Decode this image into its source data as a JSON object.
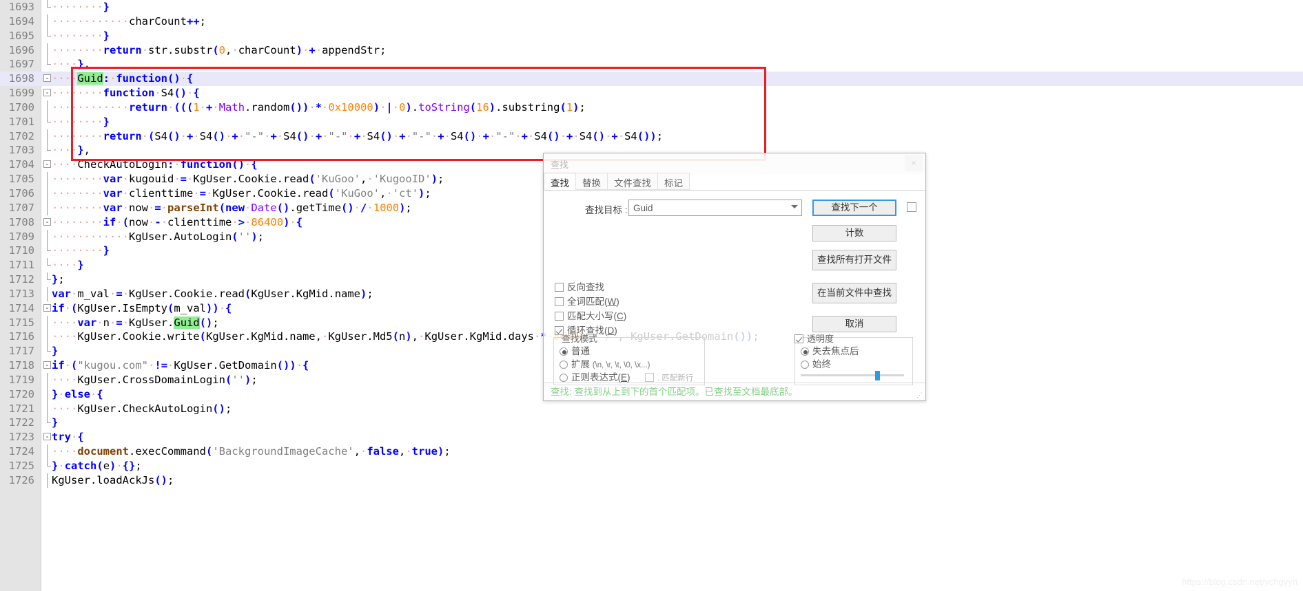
{
  "editor": {
    "first_line": 1693,
    "current_line": 1698,
    "highlight_term": "Guid",
    "lines": [
      {
        "n": 1693,
        "fold": "end",
        "html": "<span class=\"ws\">&middot;&middot;&middot;&middot;&middot;&middot;&middot;&middot;</span><span class=\"op\">}</span>"
      },
      {
        "n": 1694,
        "fold": "",
        "html": "<span class=\"ws\">&middot;&middot;&middot;&middot;&middot;&middot;&middot;&middot;&middot;&middot;&middot;&middot;</span>charCount<span class=\"op\">++</span>;"
      },
      {
        "n": 1695,
        "fold": "end",
        "html": "<span class=\"ws\">&middot;&middot;&middot;&middot;&middot;&middot;&middot;&middot;</span><span class=\"op\">}</span>"
      },
      {
        "n": 1696,
        "fold": "",
        "html": "<span class=\"ws\">&middot;&middot;&middot;&middot;&middot;&middot;&middot;&middot;</span><span class=\"kw\">return</span><span class=\"ws\">&middot;</span>str.substr<span class=\"op\">(</span><span class=\"num\">0</span>,<span class=\"ws\">&middot;</span>charCount<span class=\"op\">)</span><span class=\"ws\">&middot;</span><span class=\"op\">+</span><span class=\"ws\">&middot;</span>appendStr;"
      },
      {
        "n": 1697,
        "fold": "end",
        "html": "<span class=\"ws\">&middot;&middot;&middot;&middot;</span><span class=\"op\">}</span>,"
      },
      {
        "n": 1698,
        "fold": "box",
        "html": "<span class=\"ws\">&middot;&middot;&middot;&middot;</span><span class=\"hl\">Guid</span><span class=\"op\">:</span><span class=\"ws\">&middot;</span><span class=\"kw\">function</span><span class=\"op\">()</span><span class=\"ws\">&middot;</span><span class=\"op\">{</span>"
      },
      {
        "n": 1699,
        "fold": "box",
        "html": "<span class=\"ws\">&middot;&middot;&middot;&middot;&middot;&middot;&middot;&middot;</span><span class=\"kw\">function</span><span class=\"ws\">&middot;</span>S4<span class=\"op\">()</span><span class=\"ws\">&middot;</span><span class=\"op\">{</span>"
      },
      {
        "n": 1700,
        "fold": "",
        "html": "<span class=\"ws\">&middot;&middot;&middot;&middot;&middot;&middot;&middot;&middot;&middot;&middot;&middot;&middot;</span><span class=\"kw\">return</span><span class=\"ws\">&middot;</span><span class=\"op\">(((</span><span class=\"num\">1</span><span class=\"ws\">&middot;</span><span class=\"op\">+</span><span class=\"ws\">&middot;</span><span class=\"fn\">Math</span>.random<span class=\"op\">())</span><span class=\"ws\">&middot;</span><span class=\"op\">*</span><span class=\"ws\">&middot;</span><span class=\"num\">0x10000</span><span class=\"op\">)</span><span class=\"ws\">&middot;</span><span class=\"op\">|</span><span class=\"ws\">&middot;</span><span class=\"num\">0</span><span class=\"op\">)</span>.<span class=\"fn\">toString</span><span class=\"op\">(</span><span class=\"num\">16</span><span class=\"op\">)</span>.substring<span class=\"op\">(</span><span class=\"num\">1</span><span class=\"op\">)</span>;"
      },
      {
        "n": 1701,
        "fold": "end",
        "html": "<span class=\"ws\">&middot;&middot;&middot;&middot;&middot;&middot;&middot;&middot;</span><span class=\"op\">}</span>"
      },
      {
        "n": 1702,
        "fold": "",
        "html": "<span class=\"ws\">&middot;&middot;&middot;&middot;&middot;&middot;&middot;&middot;</span><span class=\"kw\">return</span><span class=\"ws\">&middot;</span><span class=\"op\">(</span>S4<span class=\"op\">()</span><span class=\"ws\">&middot;</span><span class=\"op\">+</span><span class=\"ws\">&middot;</span>S4<span class=\"op\">()</span><span class=\"ws\">&middot;</span><span class=\"op\">+</span><span class=\"ws\">&middot;</span><span class=\"str\">\"-\"</span><span class=\"ws\">&middot;</span><span class=\"op\">+</span><span class=\"ws\">&middot;</span>S4<span class=\"op\">()</span><span class=\"ws\">&middot;</span><span class=\"op\">+</span><span class=\"ws\">&middot;</span><span class=\"str\">\"-\"</span><span class=\"ws\">&middot;</span><span class=\"op\">+</span><span class=\"ws\">&middot;</span>S4<span class=\"op\">()</span><span class=\"ws\">&middot;</span><span class=\"op\">+</span><span class=\"ws\">&middot;</span><span class=\"str\">\"-\"</span><span class=\"ws\">&middot;</span><span class=\"op\">+</span><span class=\"ws\">&middot;</span>S4<span class=\"op\">()</span><span class=\"ws\">&middot;</span><span class=\"op\">+</span><span class=\"ws\">&middot;</span><span class=\"str\">\"-\"</span><span class=\"ws\">&middot;</span><span class=\"op\">+</span><span class=\"ws\">&middot;</span>S4<span class=\"op\">()</span><span class=\"ws\">&middot;</span><span class=\"op\">+</span><span class=\"ws\">&middot;</span>S4<span class=\"op\">()</span><span class=\"ws\">&middot;</span><span class=\"op\">+</span><span class=\"ws\">&middot;</span>S4<span class=\"op\">())</span>;"
      },
      {
        "n": 1703,
        "fold": "end",
        "html": "<span class=\"ws\">&middot;&middot;&middot;&middot;</span><span class=\"op\">}</span>,"
      },
      {
        "n": 1704,
        "fold": "box",
        "html": "<span class=\"ws\">&middot;&middot;&middot;&middot;</span>CheckAutoLogin<span class=\"op\">:</span><span class=\"ws\">&middot;</span><span class=\"kw\">function</span><span class=\"op\">()</span><span class=\"ws\">&middot;</span><span class=\"op\">{</span>"
      },
      {
        "n": 1705,
        "fold": "",
        "html": "<span class=\"ws\">&middot;&middot;&middot;&middot;&middot;&middot;&middot;&middot;</span><span class=\"kw\">var</span><span class=\"ws\">&middot;</span>kugouid<span class=\"ws\">&middot;</span><span class=\"op\">=</span><span class=\"ws\">&middot;</span>KgUser.Cookie.read<span class=\"op\">(</span><span class=\"str\">'KuGoo'</span>,<span class=\"ws\">&middot;</span><span class=\"str\">'KugooID'</span><span class=\"op\">)</span>;"
      },
      {
        "n": 1706,
        "fold": "",
        "html": "<span class=\"ws\">&middot;&middot;&middot;&middot;&middot;&middot;&middot;&middot;</span><span class=\"kw\">var</span><span class=\"ws\">&middot;</span>clienttime<span class=\"ws\">&middot;</span><span class=\"op\">=</span><span class=\"ws\">&middot;</span>KgUser.Cookie.read<span class=\"op\">(</span><span class=\"str\">'KuGoo'</span>,<span class=\"ws\">&middot;</span><span class=\"str\">'ct'</span><span class=\"op\">)</span>;"
      },
      {
        "n": 1707,
        "fold": "",
        "html": "<span class=\"ws\">&middot;&middot;&middot;&middot;&middot;&middot;&middot;&middot;</span><span class=\"kw\">var</span><span class=\"ws\">&middot;</span>now<span class=\"ws\">&middot;</span><span class=\"op\">=</span><span class=\"ws\">&middot;</span><span class=\"dark\">parseInt</span><span class=\"op\">(</span><span class=\"kw\">new</span><span class=\"ws\">&middot;</span><span class=\"fn\">Date</span><span class=\"op\">()</span>.getTime<span class=\"op\">()</span><span class=\"ws\">&middot;</span><span class=\"op\">/</span><span class=\"ws\">&middot;</span><span class=\"num\">1000</span><span class=\"op\">)</span>;"
      },
      {
        "n": 1708,
        "fold": "box",
        "html": "<span class=\"ws\">&middot;&middot;&middot;&middot;&middot;&middot;&middot;&middot;</span><span class=\"kw\">if</span><span class=\"ws\">&middot;</span><span class=\"op\">(</span>now<span class=\"ws\">&middot;</span><span class=\"op\">-</span><span class=\"ws\">&middot;</span>clienttime<span class=\"ws\">&middot;</span><span class=\"op\">&gt;</span><span class=\"ws\">&middot;</span><span class=\"num\">86400</span><span class=\"op\">)</span><span class=\"ws\">&middot;</span><span class=\"op\">{</span>"
      },
      {
        "n": 1709,
        "fold": "",
        "html": "<span class=\"ws\">&middot;&middot;&middot;&middot;&middot;&middot;&middot;&middot;&middot;&middot;&middot;&middot;</span>KgUser.AutoLogin<span class=\"op\">(</span><span class=\"str\">''</span><span class=\"op\">)</span>;"
      },
      {
        "n": 1710,
        "fold": "end",
        "html": "<span class=\"ws\">&middot;&middot;&middot;&middot;&middot;&middot;&middot;&middot;</span><span class=\"op\">}</span>"
      },
      {
        "n": 1711,
        "fold": "end",
        "html": "<span class=\"ws\">&middot;&middot;&middot;&middot;</span><span class=\"op\">}</span>"
      },
      {
        "n": 1712,
        "fold": "end",
        "html": "<span class=\"op\">}</span>;"
      },
      {
        "n": 1713,
        "fold": "",
        "html": "<span class=\"kw\">var</span><span class=\"ws\">&middot;</span>m_val<span class=\"ws\">&middot;</span><span class=\"op\">=</span><span class=\"ws\">&middot;</span>KgUser.Cookie.read<span class=\"op\">(</span>KgUser.KgMid.name<span class=\"op\">)</span>;"
      },
      {
        "n": 1714,
        "fold": "box",
        "html": "<span class=\"kw\">if</span><span class=\"ws\">&middot;</span><span class=\"op\">(</span>KgUser.IsEmpty<span class=\"op\">(</span>m_val<span class=\"op\">))</span><span class=\"ws\">&middot;</span><span class=\"op\">{</span>"
      },
      {
        "n": 1715,
        "fold": "",
        "html": "<span class=\"ws\">&middot;&middot;&middot;&middot;</span><span class=\"kw\">var</span><span class=\"ws\">&middot;</span>n<span class=\"ws\">&middot;</span><span class=\"op\">=</span><span class=\"ws\">&middot;</span>KgUser.<span class=\"hl\">Guid</span><span class=\"op\">()</span>;"
      },
      {
        "n": 1716,
        "fold": "",
        "html": "<span class=\"ws\">&middot;&middot;&middot;&middot;</span>KgUser.Cookie.write<span class=\"op\">(</span>KgUser.KgMid.name,<span class=\"ws\">&middot;</span>KgUser.Md5<span class=\"op\">(</span>n<span class=\"op\">)</span>,<span class=\"ws\">&middot;</span>KgUser.KgMid.days<span class=\"ws\">&middot;</span><span class=\"op\">*</span><span class=\"ws\">&middot;</span><span class=\"num\">86400</span>,<span class=\"ws\">&middot;</span><span class=\"str\">\"/\"</span>,<span class=\"ws\">&middot;</span>KgUser.GetDomain<span class=\"op\">())</span>;"
      },
      {
        "n": 1717,
        "fold": "end",
        "html": "<span class=\"op\">}</span>"
      },
      {
        "n": 1718,
        "fold": "box",
        "html": "<span class=\"kw\">if</span><span class=\"ws\">&middot;</span><span class=\"op\">(</span><span class=\"str\">\"kugou.com\"</span><span class=\"ws\">&middot;</span><span class=\"op\">!=</span><span class=\"ws\">&middot;</span>KgUser.GetDomain<span class=\"op\">())</span><span class=\"ws\">&middot;</span><span class=\"op\">{</span>"
      },
      {
        "n": 1719,
        "fold": "",
        "html": "<span class=\"ws\">&middot;&middot;&middot;&middot;</span>KgUser.CrossDomainLogin<span class=\"op\">(</span><span class=\"str\">''</span><span class=\"op\">)</span>;"
      },
      {
        "n": 1720,
        "fold": "",
        "html": "<span class=\"op\">}</span><span class=\"ws\">&middot;</span><span class=\"kw\">else</span><span class=\"ws\">&middot;</span><span class=\"op\">{</span>"
      },
      {
        "n": 1721,
        "fold": "",
        "html": "<span class=\"ws\">&middot;&middot;&middot;&middot;</span>KgUser.CheckAutoLogin<span class=\"op\">()</span>;"
      },
      {
        "n": 1722,
        "fold": "end",
        "html": "<span class=\"op\">}</span>"
      },
      {
        "n": 1723,
        "fold": "box",
        "html": "<span class=\"kw\">try</span><span class=\"ws\">&middot;</span><span class=\"op\">{</span>"
      },
      {
        "n": 1724,
        "fold": "",
        "html": "<span class=\"ws\">&middot;&middot;&middot;&middot;</span><span class=\"dark\">document</span>.execCommand<span class=\"op\">(</span><span class=\"str\">'BackgroundImageCache'</span>,<span class=\"ws\">&middot;</span><span class=\"kw\">false</span>,<span class=\"ws\">&middot;</span><span class=\"kw\">true</span><span class=\"op\">)</span>;"
      },
      {
        "n": 1725,
        "fold": "end",
        "html": "<span class=\"op\">}</span><span class=\"ws\">&middot;</span><span class=\"kw\">catch</span><span class=\"op\">(</span>e<span class=\"op\">)</span><span class=\"ws\">&middot;</span><span class=\"op\">{}</span>;"
      },
      {
        "n": 1726,
        "fold": "",
        "html": "KgUser.loadAckJs<span class=\"op\">()</span>;"
      }
    ],
    "plain_lines": [
      "        }",
      "            charCount++;",
      "        }",
      "        return str.substr(0, charCount) + appendStr;",
      "    },",
      "    Guid: function() {",
      "        function S4() {",
      "            return (((1 + Math.random()) * 0x10000) | 0).toString(16).substring(1);",
      "        }",
      "        return (S4() + S4() + \"-\" + S4() + \"-\" + S4() + \"-\" + S4() + \"-\" + S4() + S4() + S4());",
      "    },",
      "    CheckAutoLogin: function() {",
      "        var kugouid = KgUser.Cookie.read('KuGoo', 'KugooID');",
      "        var clienttime = KgUser.Cookie.read('KuGoo', 'ct');",
      "        var now = parseInt(new Date().getTime() / 1000);",
      "        if (now - clienttime > 86400) {",
      "            KgUser.AutoLogin('');",
      "        }",
      "    }",
      "};",
      "var m_val = KgUser.Cookie.read(KgUser.KgMid.name);",
      "if (KgUser.IsEmpty(m_val)) {",
      "    var n = KgUser.Guid();",
      "    KgUser.Cookie.write(KgUser.KgMid.name, KgUser.Md5(n), KgUser.KgMid.days * 86400, \"/\", KgUser.GetDomain());",
      "}",
      "if (\"kugou.com\" != KgUser.GetDomain()) {",
      "    KgUser.CrossDomainLogin('');",
      "} else {",
      "    KgUser.CheckAutoLogin();",
      "}",
      "try {",
      "    document.execCommand('BackgroundImageCache', false, true);",
      "} catch(e) {};",
      "KgUser.loadAckJs();"
    ]
  },
  "annotation": {
    "shape": "rectangle",
    "color": "#ee1c25",
    "covers_lines": "1697-1703"
  },
  "find_dialog": {
    "title": "查找",
    "close_label": "×",
    "tabs": [
      {
        "label": "查找",
        "active": true
      },
      {
        "label": "替换",
        "active": false
      },
      {
        "label": "文件查找",
        "active": false
      },
      {
        "label": "标记",
        "active": false
      }
    ],
    "target_label": "查找目标 :",
    "target_value": "Guid",
    "target_placeholder": "",
    "buttons": {
      "find_next": "查找下一个",
      "count": "计数",
      "find_all_open": "查找所有打开文件",
      "find_in_current": "在当前文件中查找",
      "cancel": "取消"
    },
    "keep_open_checkbox": {
      "label": "",
      "checked": false
    },
    "options": [
      {
        "label": "反向查找",
        "accel": "",
        "checked": false
      },
      {
        "label": "全词匹配",
        "accel": "W",
        "checked": false
      },
      {
        "label": "匹配大小写",
        "accel": "C",
        "checked": false
      },
      {
        "label": "循环查找",
        "accel": "D",
        "checked": true
      }
    ],
    "search_mode": {
      "legend": "查找模式",
      "options": [
        {
          "label": "普通",
          "accel": "",
          "note": "",
          "selected": true
        },
        {
          "label": "扩展",
          "accel": "",
          "note": "(\\n, \\r, \\t, \\0, \\x...)",
          "selected": false
        },
        {
          "label": "正则表达式",
          "accel": "E",
          "note": "",
          "selected": false
        }
      ],
      "matches_newline": {
        "label": ". 匹配新行",
        "checked": false
      }
    },
    "transparency": {
      "legend": "透明度",
      "enabled": true,
      "options": [
        {
          "label": "失去焦点后",
          "selected": true
        },
        {
          "label": "始终",
          "selected": false
        }
      ],
      "slider_percent": 72
    },
    "status_message": "查找: 查找到从上到下的首个匹配项。已查找至文档最底部。",
    "status_color": "#86d08a"
  },
  "watermark": {
    "text": "https://blog.csdn.net/ychgyyn"
  }
}
